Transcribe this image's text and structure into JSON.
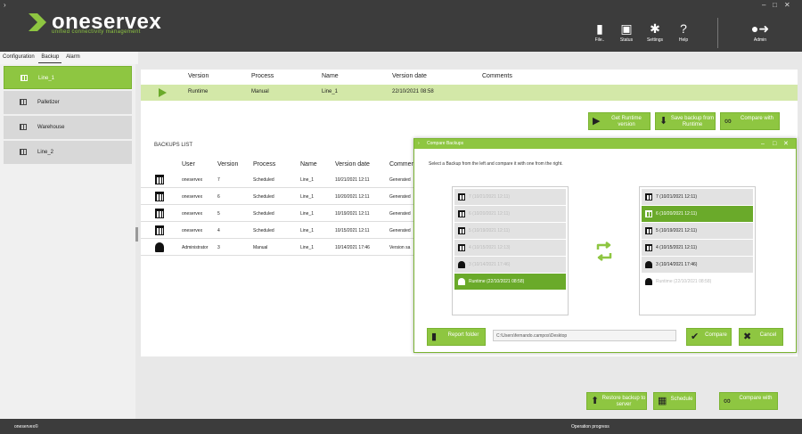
{
  "header": {
    "logo_text": "oneservex",
    "logo_tagline": "unified connectivity management",
    "buttons": [
      {
        "label": "File..",
        "icon": "file-icon"
      },
      {
        "label": "Status",
        "icon": "clipboard-icon"
      },
      {
        "label": "Settings",
        "icon": "gear-icon"
      },
      {
        "label": "Help",
        "icon": "help-icon"
      }
    ],
    "user_label": "Admin"
  },
  "nav": {
    "tabs": [
      "Configuration",
      "Backup",
      "Alarm"
    ],
    "active_tab": "Backup",
    "items": [
      "Line_1",
      "Palletizer",
      "Warehouse",
      "Line_2"
    ]
  },
  "runtime": {
    "headers": [
      "Version",
      "Process",
      "Name",
      "Version date",
      "Comments"
    ],
    "row": {
      "version": "Runtime",
      "process": "Manual",
      "name": "Line_1",
      "date": "22/10/2021 08:58",
      "comments": ""
    }
  },
  "actions_top": {
    "get_runtime": "Get Runtime version",
    "save_backup": "Save backup from Runtime",
    "compare": "Compare with"
  },
  "backups": {
    "label": "BACKUPS LIST",
    "headers": [
      "User",
      "Version",
      "Process",
      "Name",
      "Version date",
      "Comments"
    ],
    "rows": [
      {
        "icon": "calendar",
        "user": "oneservex",
        "version": "7",
        "process": "Scheduled",
        "name": "Line_1",
        "date": "10/21/2021 12:11",
        "comments": "Generated"
      },
      {
        "icon": "calendar",
        "user": "oneservex",
        "version": "6",
        "process": "Scheduled",
        "name": "Line_1",
        "date": "10/20/2021 12:11",
        "comments": "Generated"
      },
      {
        "icon": "calendar",
        "user": "oneservex",
        "version": "5",
        "process": "Scheduled",
        "name": "Line_1",
        "date": "10/19/2021 12:11",
        "comments": "Generated"
      },
      {
        "icon": "calendar",
        "user": "oneservex",
        "version": "4",
        "process": "Scheduled",
        "name": "Line_1",
        "date": "10/15/2021 12:11",
        "comments": "Generated"
      },
      {
        "icon": "user",
        "user": "Administrator",
        "version": "3",
        "process": "Manual",
        "name": "Line_1",
        "date": "10/14/2021 17:46",
        "comments": "Version sa"
      }
    ]
  },
  "dialog": {
    "title": "Compare Backups",
    "message": "Select a Backup from the left and compare it with one from the right.",
    "left_items": [
      {
        "icon": "calendar",
        "text": "7 (10/21/2021 12:11)",
        "state": "disabled"
      },
      {
        "icon": "calendar",
        "text": "6 (10/20/2021 12:11)",
        "state": "disabled"
      },
      {
        "icon": "calendar",
        "text": "5 (10/19/2021 12:11)",
        "state": "disabled"
      },
      {
        "icon": "calendar",
        "text": "4 (10/15/2021 12:13)",
        "state": "disabled"
      },
      {
        "icon": "user",
        "text": "3 (10/14/2021 17:46)",
        "state": "disabled"
      },
      {
        "icon": "user",
        "text": "Runtime (22/10/2021 08:58)",
        "state": "selected"
      }
    ],
    "right_items": [
      {
        "icon": "calendar",
        "text": "7 (10/21/2021 12:11)",
        "state": "normal"
      },
      {
        "icon": "calendar",
        "text": "6 (10/20/2021 12:11)",
        "state": "selected"
      },
      {
        "icon": "calendar",
        "text": "5 (10/19/2021 12:11)",
        "state": "normal"
      },
      {
        "icon": "calendar",
        "text": "4 (10/15/2021 12:11)",
        "state": "normal"
      },
      {
        "icon": "user",
        "text": "3 (10/14/2021 17:46)",
        "state": "normal"
      },
      {
        "icon": "user",
        "text": "Runtime (22/10/2021 08:58)",
        "state": "disabled"
      }
    ],
    "report_folder": "Report folder",
    "folder_path": "C:\\Users\\fernando.campos\\Desktop",
    "compare": "Compare",
    "cancel": "Cancel"
  },
  "actions_bottom": {
    "restore": "Restore backup to server",
    "schedule": "Schedule",
    "compare": "Compare with"
  },
  "status": {
    "left": "oneservex©",
    "center": "Operation progress"
  },
  "colors": {
    "accent": "#8ec641",
    "accent_dark": "#6aaa2a",
    "header": "#3c3c3c"
  }
}
